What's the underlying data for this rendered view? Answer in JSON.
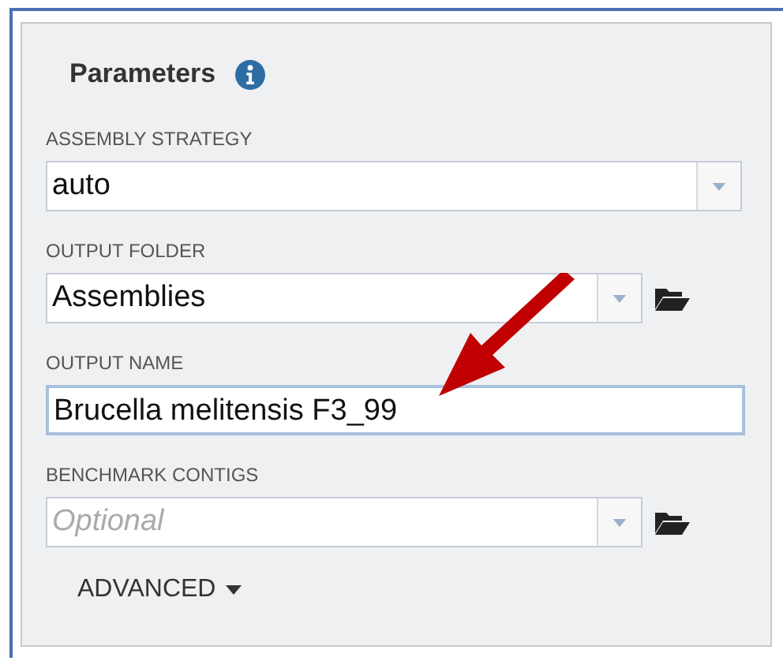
{
  "panel": {
    "title": "Parameters"
  },
  "fields": [
    {
      "kind": "select",
      "label": "ASSEMBLY STRATEGY",
      "value": "auto"
    },
    {
      "kind": "folder-select",
      "label": "OUTPUT FOLDER",
      "value": "Assemblies"
    },
    {
      "kind": "text",
      "label": "OUTPUT NAME",
      "value": "Brucella melitensis F3_99"
    },
    {
      "kind": "folder-select",
      "label": "BENCHMARK CONTIGS",
      "placeholder": "Optional"
    }
  ],
  "advanced": {
    "label": "ADVANCED",
    "expanded": false
  }
}
